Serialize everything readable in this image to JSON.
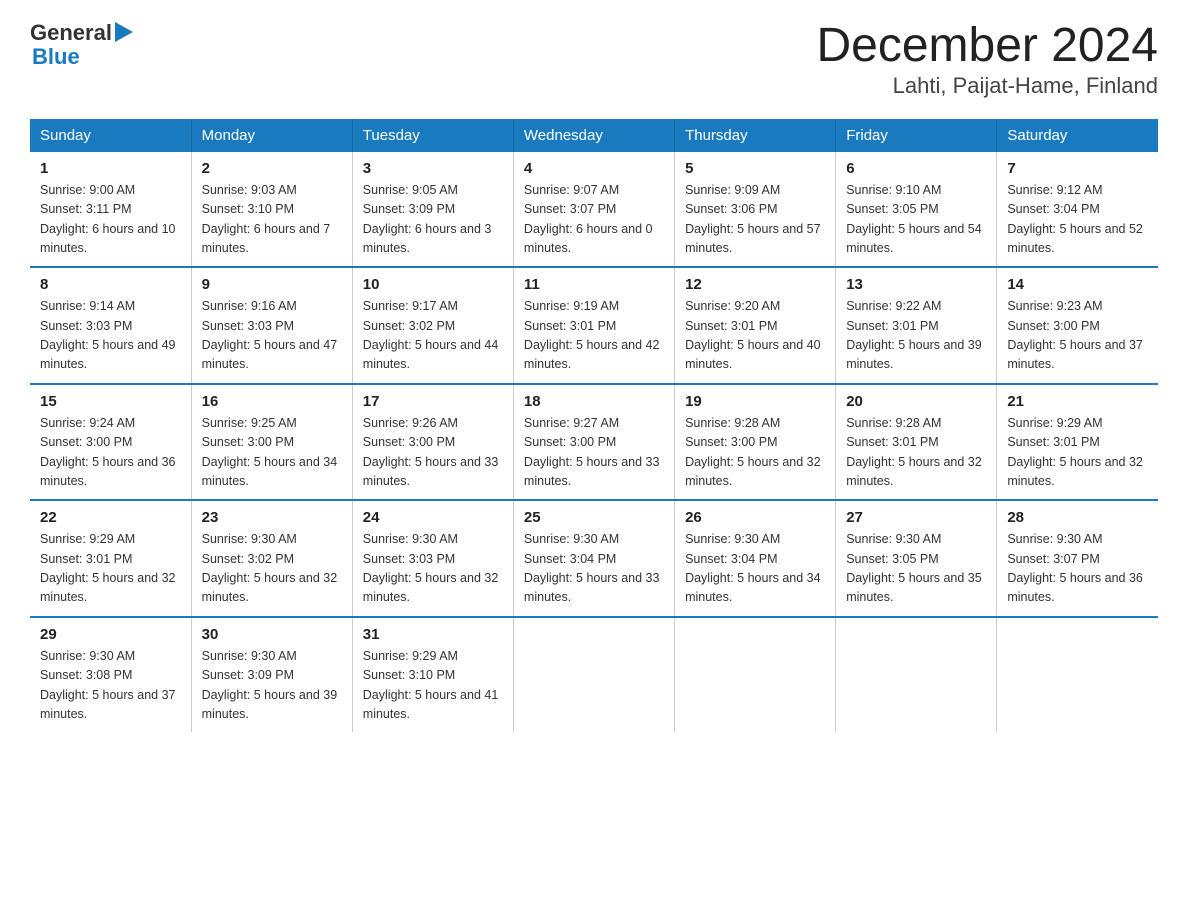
{
  "logo": {
    "general": "General",
    "blue": "Blue"
  },
  "title": "December 2024",
  "subtitle": "Lahti, Paijat-Hame, Finland",
  "days_header": [
    "Sunday",
    "Monday",
    "Tuesday",
    "Wednesday",
    "Thursday",
    "Friday",
    "Saturday"
  ],
  "weeks": [
    [
      {
        "num": "1",
        "sunrise": "9:00 AM",
        "sunset": "3:11 PM",
        "daylight": "6 hours and 10 minutes."
      },
      {
        "num": "2",
        "sunrise": "9:03 AM",
        "sunset": "3:10 PM",
        "daylight": "6 hours and 7 minutes."
      },
      {
        "num": "3",
        "sunrise": "9:05 AM",
        "sunset": "3:09 PM",
        "daylight": "6 hours and 3 minutes."
      },
      {
        "num": "4",
        "sunrise": "9:07 AM",
        "sunset": "3:07 PM",
        "daylight": "6 hours and 0 minutes."
      },
      {
        "num": "5",
        "sunrise": "9:09 AM",
        "sunset": "3:06 PM",
        "daylight": "5 hours and 57 minutes."
      },
      {
        "num": "6",
        "sunrise": "9:10 AM",
        "sunset": "3:05 PM",
        "daylight": "5 hours and 54 minutes."
      },
      {
        "num": "7",
        "sunrise": "9:12 AM",
        "sunset": "3:04 PM",
        "daylight": "5 hours and 52 minutes."
      }
    ],
    [
      {
        "num": "8",
        "sunrise": "9:14 AM",
        "sunset": "3:03 PM",
        "daylight": "5 hours and 49 minutes."
      },
      {
        "num": "9",
        "sunrise": "9:16 AM",
        "sunset": "3:03 PM",
        "daylight": "5 hours and 47 minutes."
      },
      {
        "num": "10",
        "sunrise": "9:17 AM",
        "sunset": "3:02 PM",
        "daylight": "5 hours and 44 minutes."
      },
      {
        "num": "11",
        "sunrise": "9:19 AM",
        "sunset": "3:01 PM",
        "daylight": "5 hours and 42 minutes."
      },
      {
        "num": "12",
        "sunrise": "9:20 AM",
        "sunset": "3:01 PM",
        "daylight": "5 hours and 40 minutes."
      },
      {
        "num": "13",
        "sunrise": "9:22 AM",
        "sunset": "3:01 PM",
        "daylight": "5 hours and 39 minutes."
      },
      {
        "num": "14",
        "sunrise": "9:23 AM",
        "sunset": "3:00 PM",
        "daylight": "5 hours and 37 minutes."
      }
    ],
    [
      {
        "num": "15",
        "sunrise": "9:24 AM",
        "sunset": "3:00 PM",
        "daylight": "5 hours and 36 minutes."
      },
      {
        "num": "16",
        "sunrise": "9:25 AM",
        "sunset": "3:00 PM",
        "daylight": "5 hours and 34 minutes."
      },
      {
        "num": "17",
        "sunrise": "9:26 AM",
        "sunset": "3:00 PM",
        "daylight": "5 hours and 33 minutes."
      },
      {
        "num": "18",
        "sunrise": "9:27 AM",
        "sunset": "3:00 PM",
        "daylight": "5 hours and 33 minutes."
      },
      {
        "num": "19",
        "sunrise": "9:28 AM",
        "sunset": "3:00 PM",
        "daylight": "5 hours and 32 minutes."
      },
      {
        "num": "20",
        "sunrise": "9:28 AM",
        "sunset": "3:01 PM",
        "daylight": "5 hours and 32 minutes."
      },
      {
        "num": "21",
        "sunrise": "9:29 AM",
        "sunset": "3:01 PM",
        "daylight": "5 hours and 32 minutes."
      }
    ],
    [
      {
        "num": "22",
        "sunrise": "9:29 AM",
        "sunset": "3:01 PM",
        "daylight": "5 hours and 32 minutes."
      },
      {
        "num": "23",
        "sunrise": "9:30 AM",
        "sunset": "3:02 PM",
        "daylight": "5 hours and 32 minutes."
      },
      {
        "num": "24",
        "sunrise": "9:30 AM",
        "sunset": "3:03 PM",
        "daylight": "5 hours and 32 minutes."
      },
      {
        "num": "25",
        "sunrise": "9:30 AM",
        "sunset": "3:04 PM",
        "daylight": "5 hours and 33 minutes."
      },
      {
        "num": "26",
        "sunrise": "9:30 AM",
        "sunset": "3:04 PM",
        "daylight": "5 hours and 34 minutes."
      },
      {
        "num": "27",
        "sunrise": "9:30 AM",
        "sunset": "3:05 PM",
        "daylight": "5 hours and 35 minutes."
      },
      {
        "num": "28",
        "sunrise": "9:30 AM",
        "sunset": "3:07 PM",
        "daylight": "5 hours and 36 minutes."
      }
    ],
    [
      {
        "num": "29",
        "sunrise": "9:30 AM",
        "sunset": "3:08 PM",
        "daylight": "5 hours and 37 minutes."
      },
      {
        "num": "30",
        "sunrise": "9:30 AM",
        "sunset": "3:09 PM",
        "daylight": "5 hours and 39 minutes."
      },
      {
        "num": "31",
        "sunrise": "9:29 AM",
        "sunset": "3:10 PM",
        "daylight": "5 hours and 41 minutes."
      },
      {
        "num": "",
        "sunrise": "",
        "sunset": "",
        "daylight": ""
      },
      {
        "num": "",
        "sunrise": "",
        "sunset": "",
        "daylight": ""
      },
      {
        "num": "",
        "sunrise": "",
        "sunset": "",
        "daylight": ""
      },
      {
        "num": "",
        "sunrise": "",
        "sunset": "",
        "daylight": ""
      }
    ]
  ]
}
